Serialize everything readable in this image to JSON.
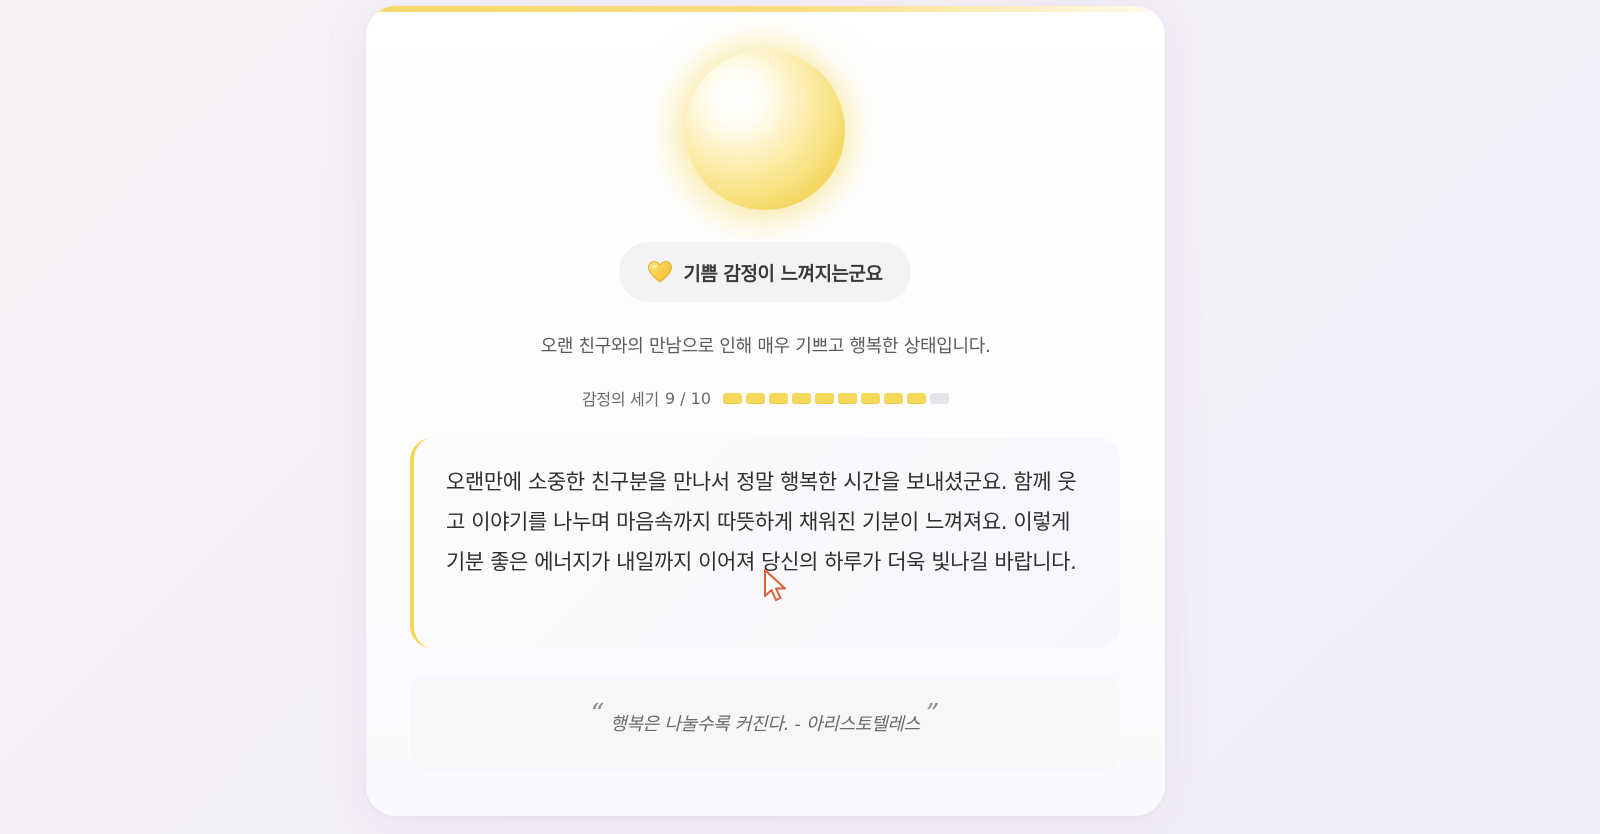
{
  "emotion": {
    "icon": "yellow-heart-icon",
    "label": "기쁨 감정이 느껴지는군요",
    "summary": "오랜 친구와의 만남으로 인해 매우 기쁘고 행복한 상태입니다.",
    "accent_color": "#f4d556"
  },
  "intensity": {
    "label": "감정의 세기",
    "display": "9 / 10",
    "value": 9,
    "max": 10
  },
  "message": {
    "text": "오랜만에 소중한 친구분을 만나서 정말 행복한 시간을 보내셨군요. 함께 웃고 이야기를 나누며 마음속까지 따뜻하게 채워진 기분이 느껴져요. 이렇게 기분 좋은 에너지가 내일까지 이어져 당신의 하루가 더욱 빛나길 바랍니다."
  },
  "quote": {
    "open_mark": "“",
    "text": "행복은 나눌수록 커진다. - 아리스토텔레스",
    "close_mark": "”"
  }
}
